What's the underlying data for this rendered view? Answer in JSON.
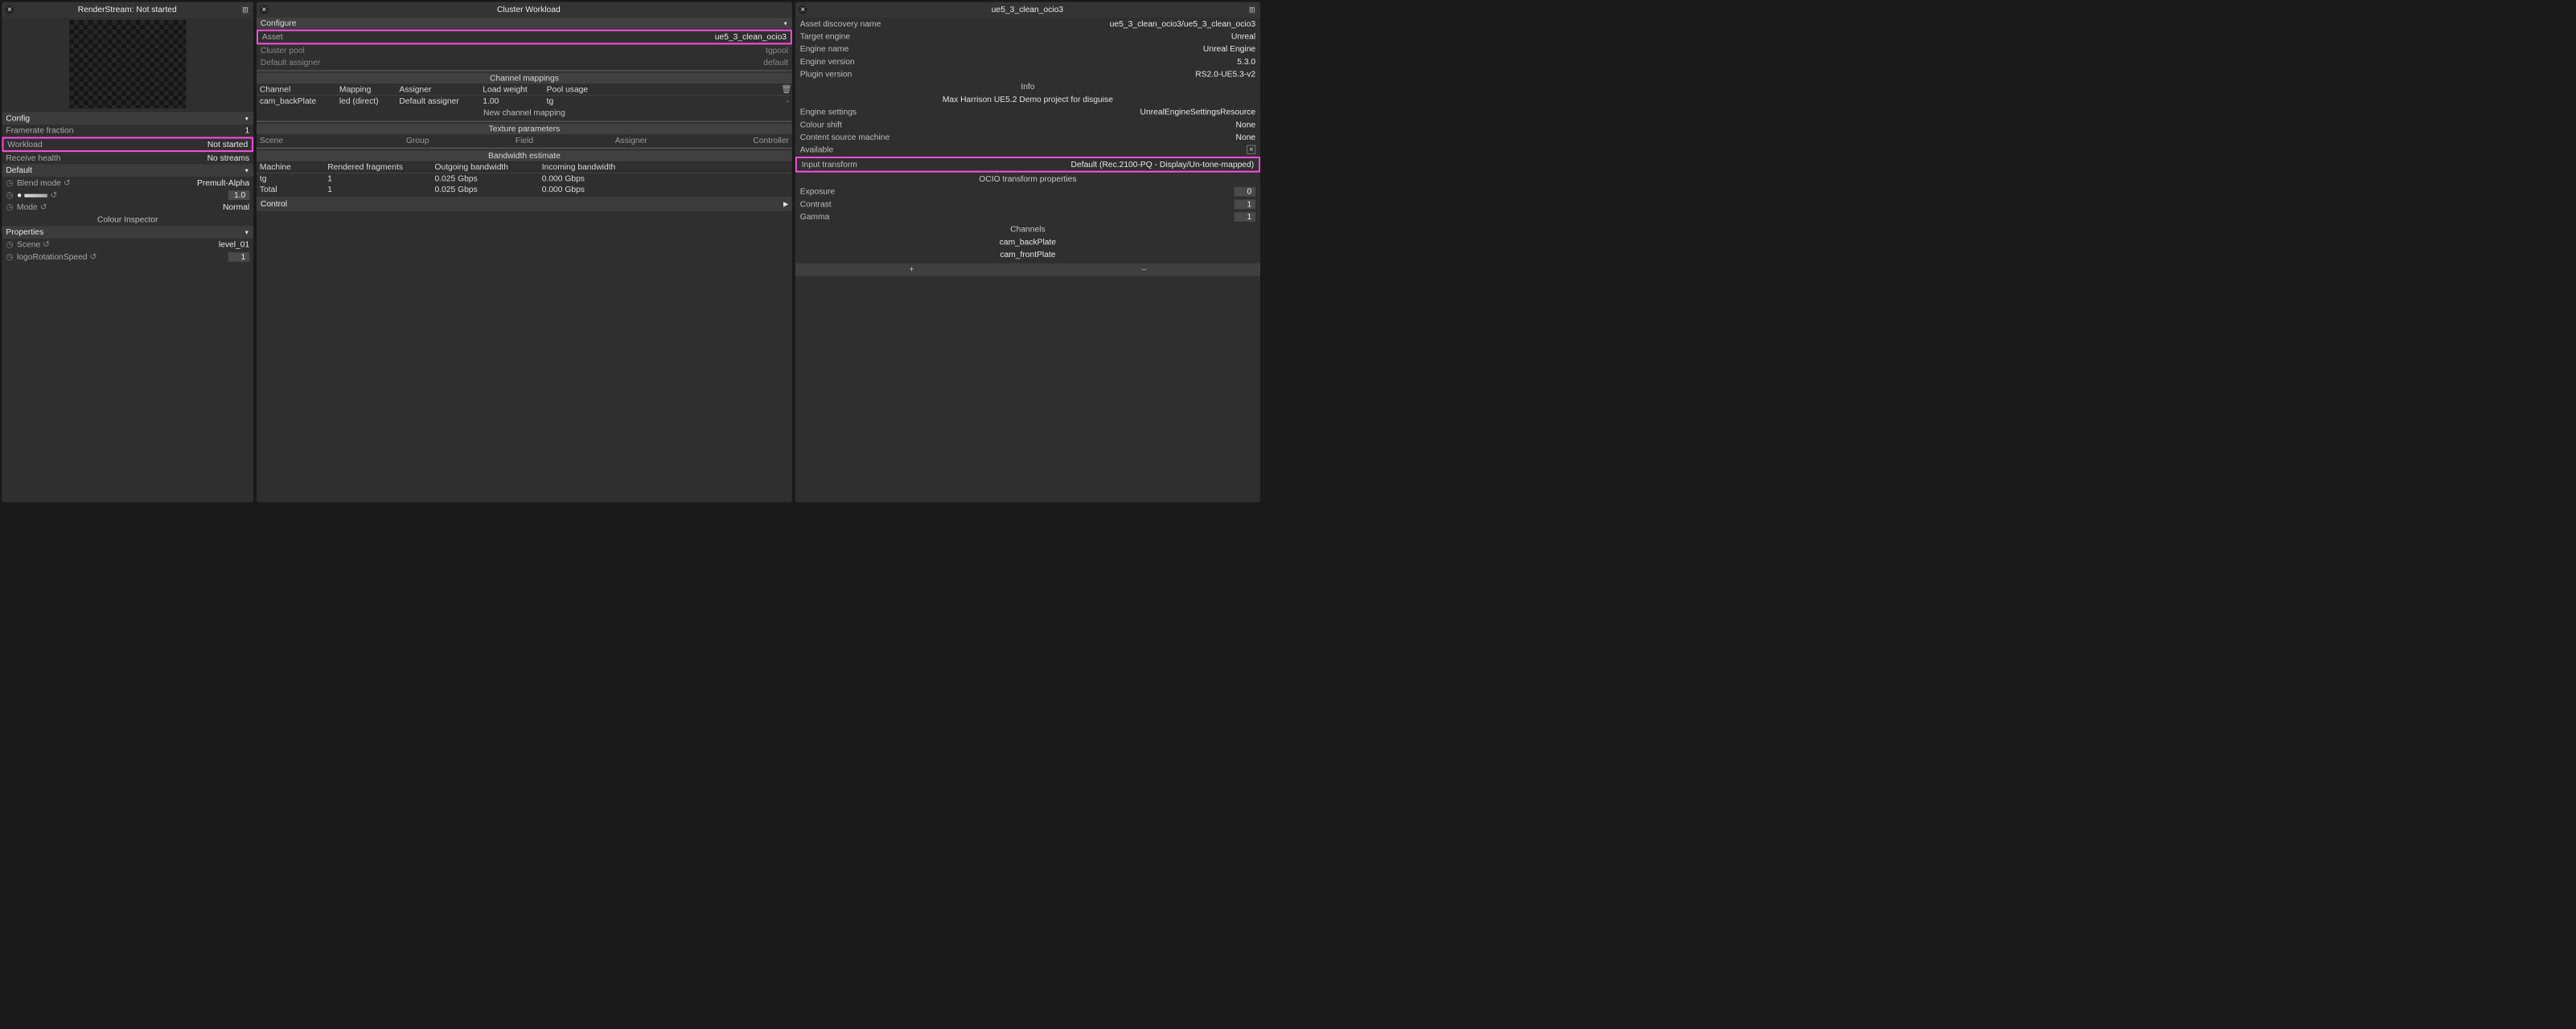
{
  "left": {
    "title": "RenderStream: Not started",
    "config": {
      "header": "Config",
      "framerate_label": "Framerate fraction",
      "framerate_value": "1",
      "workload_label": "Workload",
      "workload_value": "Not started",
      "receive_label": "Receive health",
      "receive_value": "No streams"
    },
    "default": {
      "header": "Default",
      "blend_label": "Blend mode",
      "blend_value": "Premult-Alpha",
      "opacity_value": "1.0",
      "mode_label": "Mode",
      "mode_value": "Normal",
      "inspector": "Colour Inspector"
    },
    "props": {
      "header": "Properties",
      "scene_label": "Scene",
      "scene_value": "level_01",
      "logo_label": "logoRotationSpeed",
      "logo_value": "1"
    }
  },
  "mid": {
    "title": "Cluster Workload",
    "configure": "Configure",
    "asset_label": "Asset",
    "asset_value": "ue5_3_clean_ocio3",
    "pool_label": "Cluster pool",
    "pool_value": "tgpool",
    "assigner_label": "Default assigner",
    "assigner_value": "default",
    "ch_map_header": "Channel mappings",
    "ch_cols": {
      "channel": "Channel",
      "mapping": "Mapping",
      "assigner": "Assigner",
      "load": "Load weight",
      "pool": "Pool usage"
    },
    "ch_row": {
      "channel": "cam_backPlate",
      "mapping": "led (direct)",
      "assigner": "Default assigner",
      "load": "1.00",
      "pool": "tg",
      "trash": "-"
    },
    "new_mapping": "New channel mapping",
    "tex_header": "Texture parameters",
    "tex_cols": {
      "scene": "Scene",
      "group": "Group",
      "field": "Field",
      "assigner": "Assigner",
      "controller": "Controller"
    },
    "bw_header": "Bandwidth estimate",
    "bw_cols": {
      "machine": "Machine",
      "rendered": "Rendered fragments",
      "out": "Outgoing bandwidth",
      "in": "Incoming bandwidth"
    },
    "bw_rows": [
      {
        "machine": "tg",
        "rendered": "1",
        "out": "0.025 Gbps",
        "in": "0.000 Gbps"
      },
      {
        "machine": "Total",
        "rendered": "1",
        "out": "0.025 Gbps",
        "in": "0.000 Gbps"
      }
    ],
    "control": "Control"
  },
  "right": {
    "title": "ue5_3_clean_ocio3",
    "rows": [
      {
        "label": "Asset discovery name",
        "value": "ue5_3_clean_ocio3/ue5_3_clean_ocio3"
      },
      {
        "label": "Target engine",
        "value": "Unreal"
      },
      {
        "label": "Engine name",
        "value": "Unreal Engine"
      },
      {
        "label": "Engine version",
        "value": "5.3.0"
      },
      {
        "label": "Plugin version",
        "value": "RS2.0-UE5.3-v2"
      }
    ],
    "info_header": "Info",
    "info_text": "Max  Harrison UE5.2 Demo project for disguise",
    "rows2": [
      {
        "label": "Engine settings",
        "value": "UnrealEngineSettingsResource"
      },
      {
        "label": "Colour shift",
        "value": "None"
      },
      {
        "label": "Content source machine",
        "value": "None"
      }
    ],
    "available_label": "Available",
    "input_label": "Input transform",
    "input_value": "Default (Rec.2100-PQ - Display/Un-tone-mapped)",
    "ocio_header": "OCIO transform properties",
    "ocio_rows": [
      {
        "label": "Exposure",
        "value": "0"
      },
      {
        "label": "Contrast",
        "value": "1"
      },
      {
        "label": "Gamma",
        "value": "1"
      }
    ],
    "channels_header": "Channels",
    "channels": [
      "cam_backPlate",
      "cam_frontPlate"
    ],
    "plus": "+",
    "minus": "–"
  }
}
